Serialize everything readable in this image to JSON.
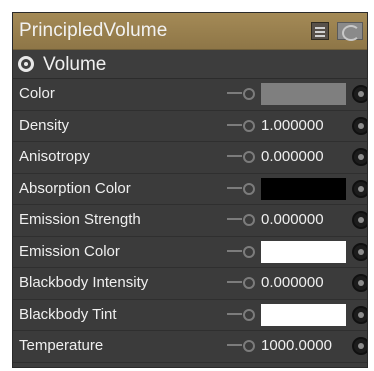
{
  "node": {
    "title": "PrincipledVolume",
    "section_label": "Volume",
    "rows": [
      {
        "label": "Color",
        "kind": "swatch",
        "swatch_color": "#7f7f7f",
        "value": ""
      },
      {
        "label": "Density",
        "kind": "number",
        "value": "1.000000"
      },
      {
        "label": "Anisotropy",
        "kind": "number",
        "value": "0.000000"
      },
      {
        "label": "Absorption Color",
        "kind": "swatch",
        "swatch_color": "#000000",
        "value": ""
      },
      {
        "label": "Emission Strength",
        "kind": "number",
        "value": "0.000000"
      },
      {
        "label": "Emission Color",
        "kind": "swatch",
        "swatch_color": "#ffffff",
        "value": ""
      },
      {
        "label": "Blackbody Intensity",
        "kind": "number",
        "value": "0.000000"
      },
      {
        "label": "Blackbody Tint",
        "kind": "swatch",
        "swatch_color": "#ffffff",
        "value": ""
      },
      {
        "label": "Temperature",
        "kind": "number",
        "value": "1000.0000"
      }
    ]
  },
  "colors": {
    "header_bg": "#9a8250",
    "panel_bg": "#3c3c3c",
    "text": "#efefef"
  },
  "icons": {
    "header_buttons": [
      "list-icon",
      "preview-icon"
    ],
    "section": "eye-icon",
    "row_link": "link-icon",
    "row_socket": "socket-icon"
  }
}
